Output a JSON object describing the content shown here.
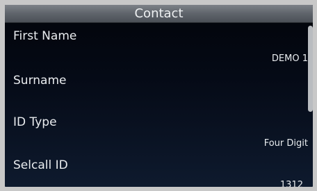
{
  "header": {
    "title": "Contact"
  },
  "fields": [
    {
      "label": "First Name",
      "value": "DEMO 1"
    },
    {
      "label": "Surname",
      "value": ""
    },
    {
      "label": "ID Type",
      "value": "Four Digit"
    },
    {
      "label": "Selcall ID",
      "value": "1312"
    }
  ],
  "colors": {
    "title_bar": "#6b7077",
    "background_top": "#02040a",
    "background_bottom": "#0e1a2e",
    "text": "#e9ecef",
    "scrollbar": "#b9bcc0"
  }
}
